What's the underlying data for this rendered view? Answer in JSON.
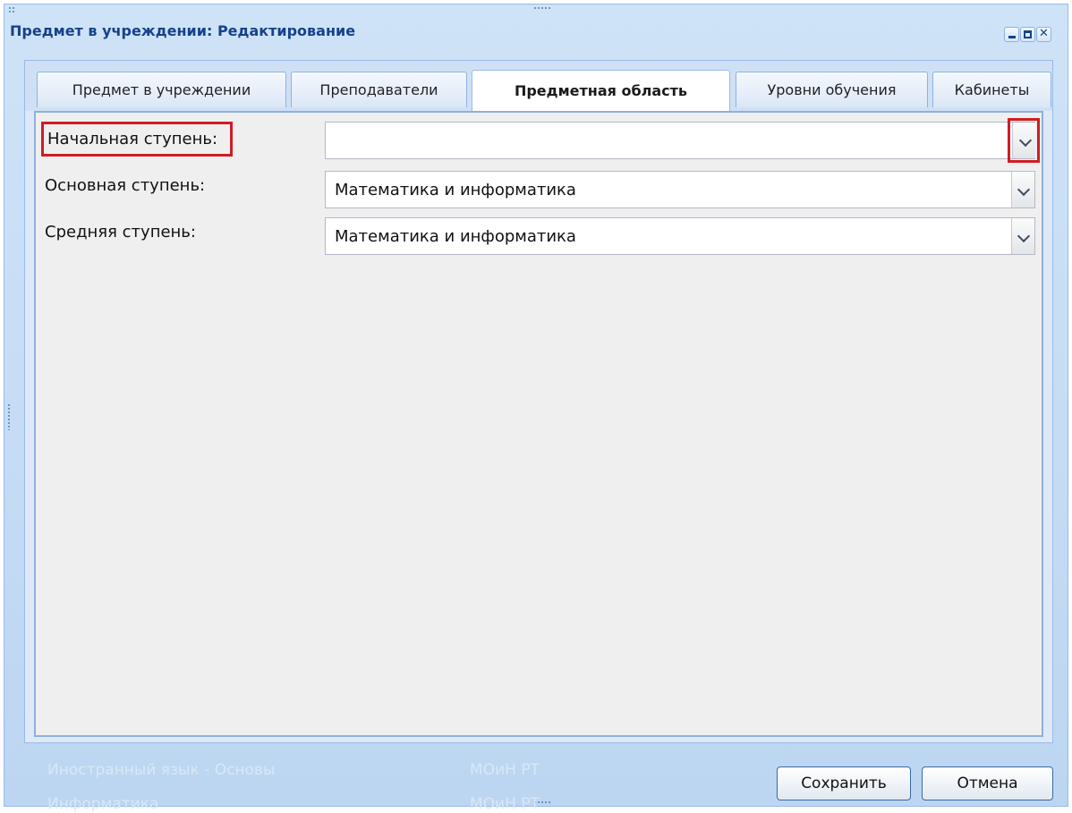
{
  "window": {
    "title": "Предмет в учреждении: Редактирование"
  },
  "tabs": [
    {
      "label": "Предмет в учреждении",
      "active": false
    },
    {
      "label": "Преподаватели",
      "active": false
    },
    {
      "label": "Предметная область",
      "active": true
    },
    {
      "label": "Уровни обучения",
      "active": false
    },
    {
      "label": "Кабинеты",
      "active": false
    }
  ],
  "form": {
    "fields": [
      {
        "label": "Начальная ступень:",
        "value": "",
        "highlighted": true
      },
      {
        "label": "Основная ступень:",
        "value": "Математика и информатика",
        "highlighted": false
      },
      {
        "label": "Средняя ступень:",
        "value": "Математика и информатика",
        "highlighted": false
      }
    ]
  },
  "background_rows": [
    {
      "name": "Иностранный язык - Основы",
      "org": "МОиН РТ"
    },
    {
      "name": "Информатика",
      "org": "МОиН РТ"
    }
  ],
  "buttons": {
    "save": "Сохранить",
    "cancel": "Отмена"
  },
  "colors": {
    "window_bg": "#cfe3f7",
    "title_text": "#15428b",
    "highlight": "#d01c24",
    "form_bg": "#efefef"
  },
  "icons": {
    "minimize": "minimize-icon",
    "maximize": "maximize-icon",
    "close": "close-icon",
    "dropdown": "chevron-down-icon"
  }
}
